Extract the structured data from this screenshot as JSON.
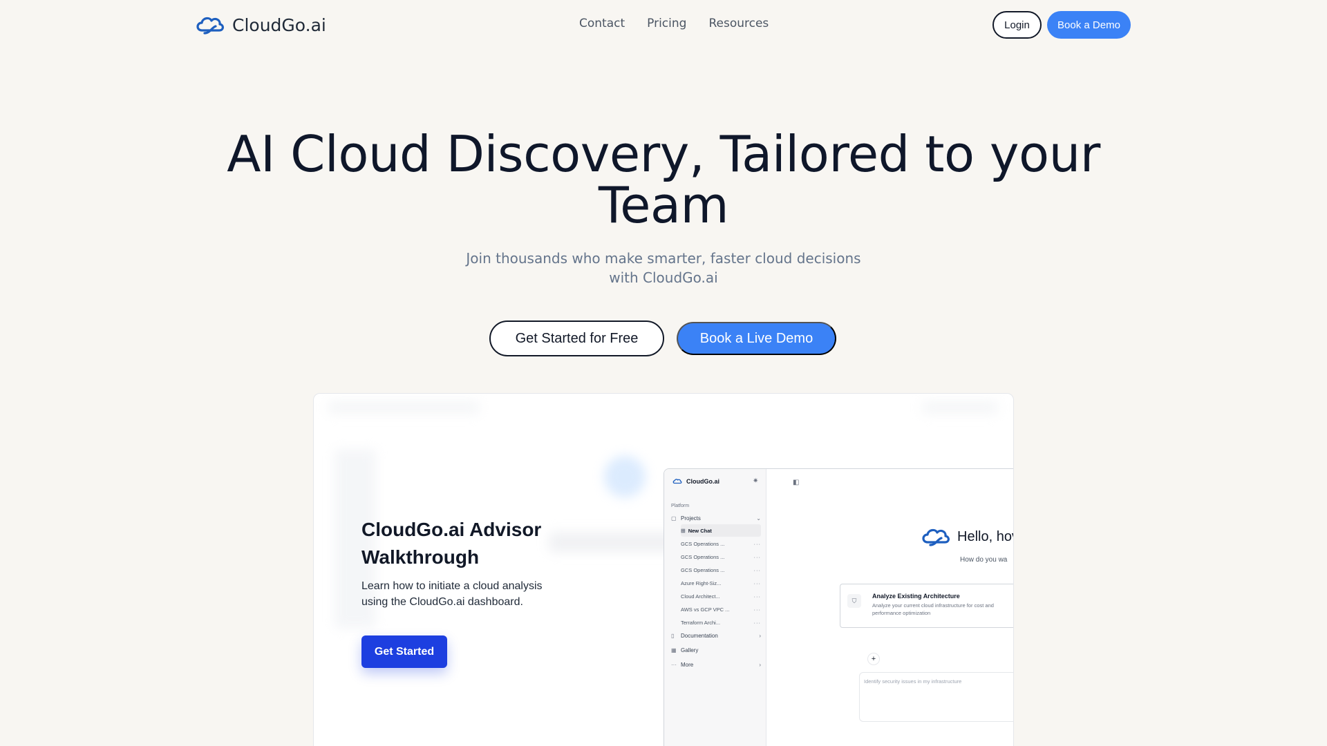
{
  "nav": {
    "brand": "CloudGo.ai",
    "links": [
      "Contact",
      "Pricing",
      "Resources"
    ],
    "login_label": "Login",
    "demo_label": "Book a Demo"
  },
  "hero": {
    "title": "AI Cloud Discovery, Tailored to your Team",
    "subtitle": "Join thousands who make smarter, faster cloud decisions with CloudGo.ai",
    "cta_primary": "Get Started for Free",
    "cta_secondary": "Book a Live Demo"
  },
  "walkthrough": {
    "title": "CloudGo.ai Advisor Walkthrough",
    "description": "Learn how to initiate a cloud analysis using the CloudGo.ai dashboard.",
    "button_label": "Get Started"
  },
  "app": {
    "logo": "CloudGo.ai",
    "section_label": "Platform",
    "projects_label": "Projects",
    "project_items": [
      "New Chat",
      "GCS Operations ...",
      "GCS Operations ...",
      "GCS Operations ...",
      "Azure Right-Siz...",
      "Cloud Architect...",
      "AWS vs GCP VPC ...",
      "Terraform Archi..."
    ],
    "documentation_label": "Documentation",
    "gallery_label": "Gallery",
    "more_label": "More",
    "hello": "Hello, hov",
    "howdo": "How do you wa",
    "analyze_title": "Analyze Existing Architecture",
    "analyze_desc": "Analyze your current cloud infrastructure for cost and performance optimization",
    "prompt_placeholder": "Identify security issues in my infrastructure"
  },
  "colors": {
    "background": "#f8f6f2",
    "accent": "#3b82f6",
    "walkthrough_button": "#1d3fe0",
    "logo_blue": "#1e5fbf"
  }
}
